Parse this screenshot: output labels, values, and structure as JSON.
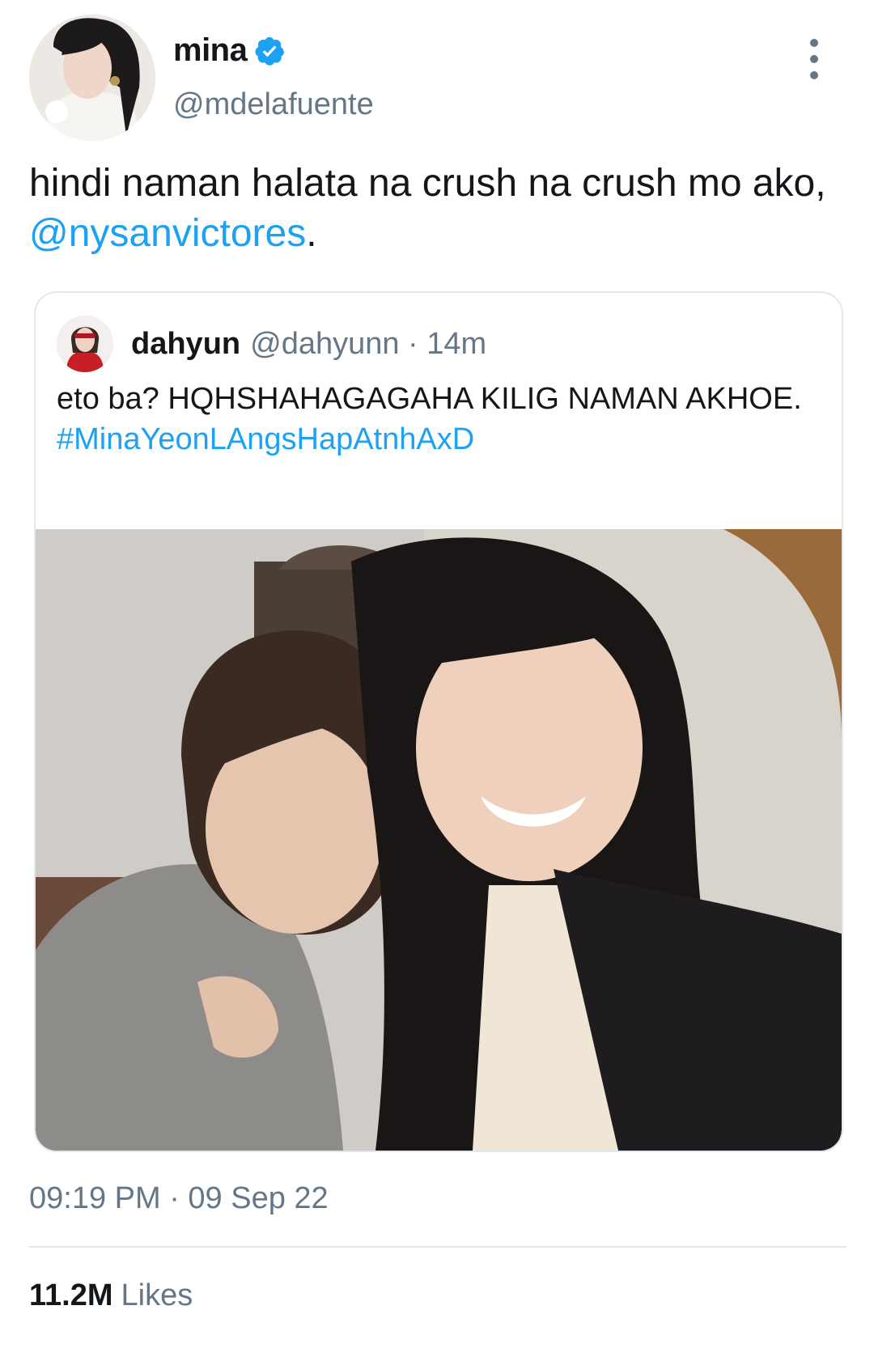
{
  "tweet": {
    "author": {
      "display_name": "mina",
      "handle": "@mdelafuente",
      "verified_icon": "verified-badge-icon"
    },
    "text_before": "hindi naman halata na crush na crush mo ako, ",
    "mention": "@nysanvictores",
    "text_after": ".",
    "timestamp": "09:19 PM · 09 Sep 22",
    "stats": {
      "likes_count": "11.2M",
      "likes_label": "Likes"
    }
  },
  "quoted": {
    "author_name": "dahyun",
    "author_meta": "@dahyunn · 14m",
    "text": "eto ba? HQHSHAHAGAGAHA KILIG NAMAN AKHOE.",
    "hashtag": "#MinaYeonLAngsHapAtnhAxD"
  },
  "colors": {
    "accent": "#1da1f2",
    "muted": "#657786",
    "text": "#14171a",
    "border": "#e1e8ed"
  }
}
